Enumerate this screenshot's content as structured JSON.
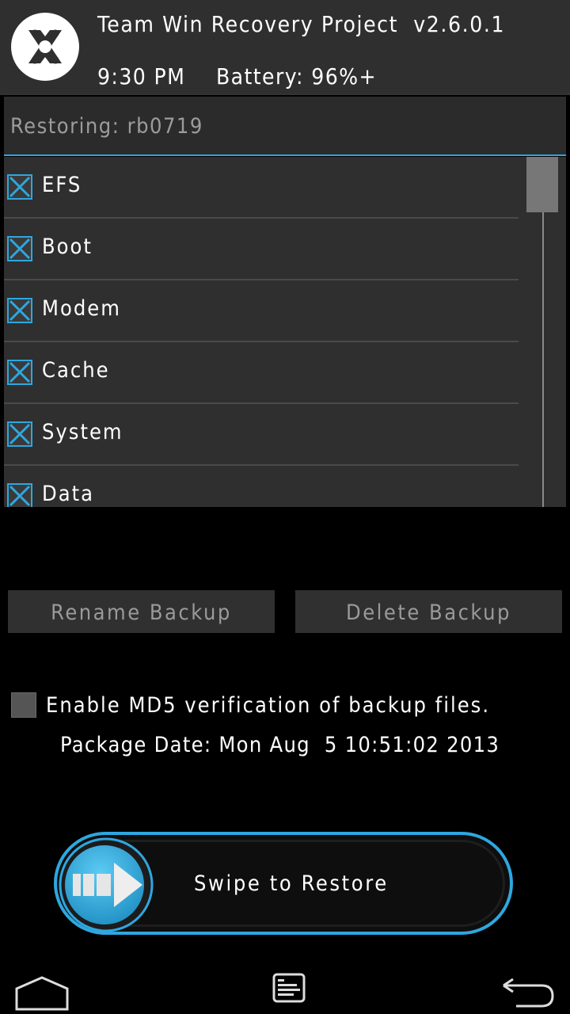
{
  "header": {
    "title": "Team Win Recovery Project  v2.6.0.1",
    "time": "9:30 PM",
    "battery": "Battery: 96%+"
  },
  "restoring": {
    "label": "Restoring: rb0719"
  },
  "partitions": [
    {
      "label": "EFS",
      "checked": true
    },
    {
      "label": "Boot",
      "checked": true
    },
    {
      "label": "Modem",
      "checked": true
    },
    {
      "label": "Cache",
      "checked": true
    },
    {
      "label": "System",
      "checked": true
    },
    {
      "label": "Data",
      "checked": true
    }
  ],
  "buttons": {
    "rename": "Rename Backup",
    "delete": "Delete Backup"
  },
  "md5": {
    "label": "Enable MD5 verification of backup files.",
    "checked": false
  },
  "package_date": "Package Date: Mon Aug  5 10:51:02 2013",
  "swipe": {
    "label": "Swipe to Restore"
  },
  "nav": {
    "home": "home-icon",
    "console": "console-icon",
    "back": "back-icon"
  },
  "colors": {
    "accent": "#2ea7df",
    "panel": "#2f2f2f",
    "background": "#000000"
  }
}
